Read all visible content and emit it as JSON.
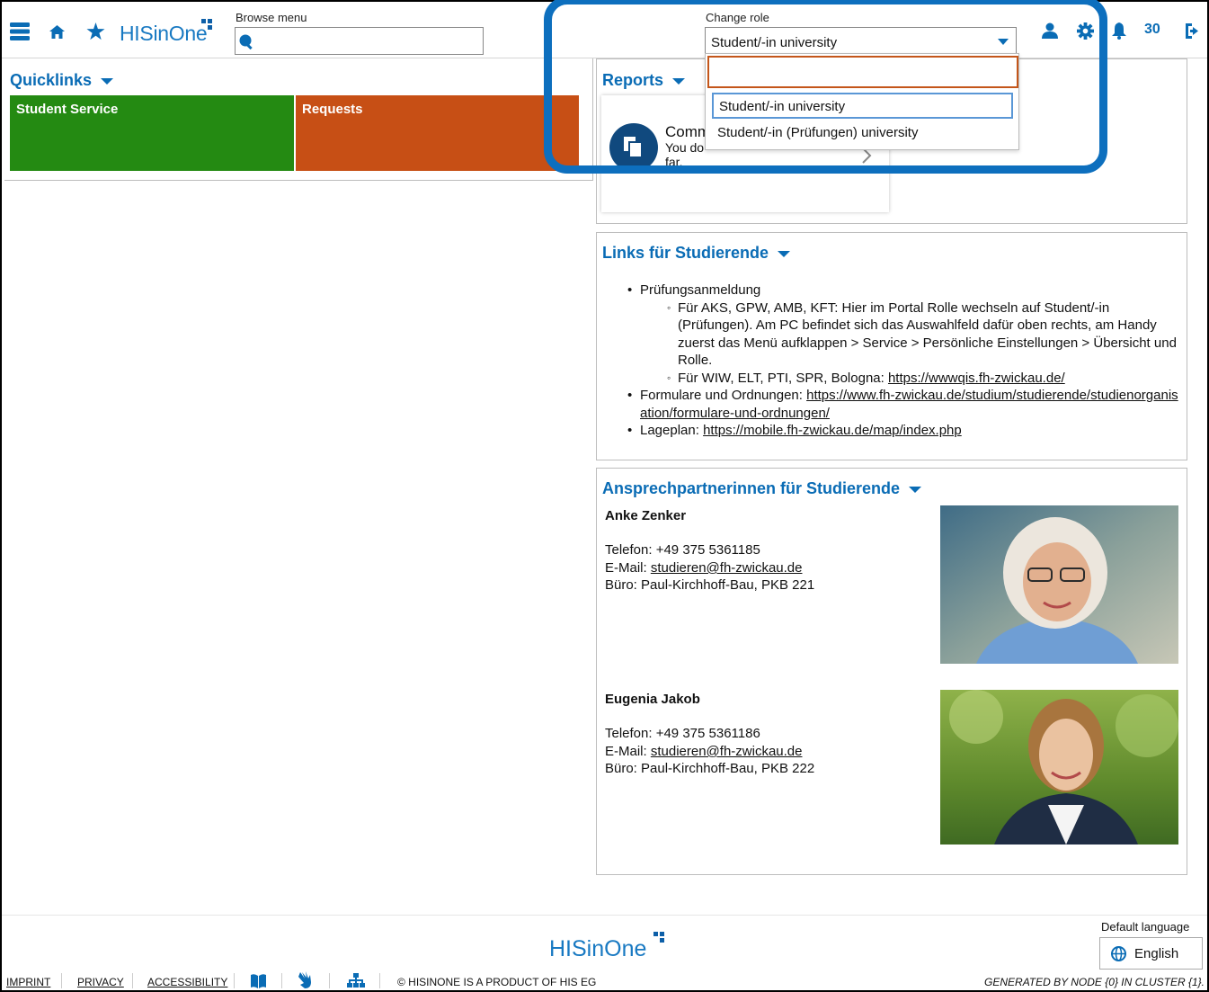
{
  "header": {
    "logo": "HISinOne",
    "browse_label": "Browse menu",
    "browse_placeholder": "",
    "role_label": "Change role",
    "role_value": "Student/-in university",
    "notification_count": "30"
  },
  "role_dropdown": {
    "filter_value": "",
    "options": [
      "Student/-in university",
      "Student/-in (Prüfungen) university"
    ]
  },
  "quicklinks": {
    "title": "Quicklinks",
    "tiles": [
      {
        "label": "Student Service",
        "color": "#248a12"
      },
      {
        "label": "Requests",
        "color": "#c74f15"
      }
    ]
  },
  "reports": {
    "title": "Reports",
    "card_title": "Comm",
    "card_text_1": "You do",
    "card_text_2": "far."
  },
  "links_panel": {
    "title": "Links für Studierende",
    "item1": "Prüfungsanmeldung",
    "sub1": "Für AKS, GPW, AMB, KFT: Hier im Portal Rolle wechseln auf Student/-in (Prüfungen). Am PC befindet sich das Auswahlfeld dafür oben rechts, am Handy zuerst das Menü aufklappen > Service > Persönliche Einstellungen > Übersicht und Rolle.",
    "sub2_prefix": "Für WIW, ELT, PTI, SPR, Bologna: ",
    "sub2_link": "https://wwwqis.fh-zwickau.de/",
    "item2_prefix": "Formulare und Ordnungen: ",
    "item2_link": "https://www.fh-zwickau.de/studium/studierende/studienorganisation/formulare-und-ordnungen/",
    "item3_prefix": "Lageplan: ",
    "item3_link": "https://mobile.fh-zwickau.de/map/index.php"
  },
  "contacts_panel": {
    "title": "Ansprechpartnerinnen für Studierende",
    "contacts": [
      {
        "name": "Anke Zenker",
        "phone": "Telefon: +49 375 5361185",
        "email_label": "E-Mail: ",
        "email": "studieren@fh-zwickau.de",
        "office": "Büro: Paul-Kirchhoff-Bau, PKB 221"
      },
      {
        "name": "Eugenia Jakob",
        "phone": "Telefon: +49 375 5361186",
        "email_label": "E-Mail: ",
        "email": "studieren@fh-zwickau.de",
        "office": "Büro: Paul-Kirchhoff-Bau, PKB 222"
      }
    ]
  },
  "footer": {
    "logo": "HISinOne",
    "imprint": "IMPRINT",
    "privacy": "PRIVACY",
    "accessibility": "ACCESSIBILITY",
    "copyright": "© HISINONE IS A PRODUCT OF HIS EG",
    "language_label": "Default language",
    "language_button": "English",
    "generated": "GENERATED BY NODE {0} IN CLUSTER {1}."
  },
  "icons": [
    "menu-icon",
    "home-icon",
    "star-icon",
    "search-icon",
    "user-icon",
    "gear-icon",
    "bell-icon",
    "logout-icon",
    "report-icon",
    "book-icon",
    "sign-language-icon",
    "sitemap-icon",
    "globe-icon"
  ],
  "colors": {
    "accent": "#0a6cb5",
    "highlight": "#0d6fbe",
    "filter_border": "#c4561a"
  }
}
